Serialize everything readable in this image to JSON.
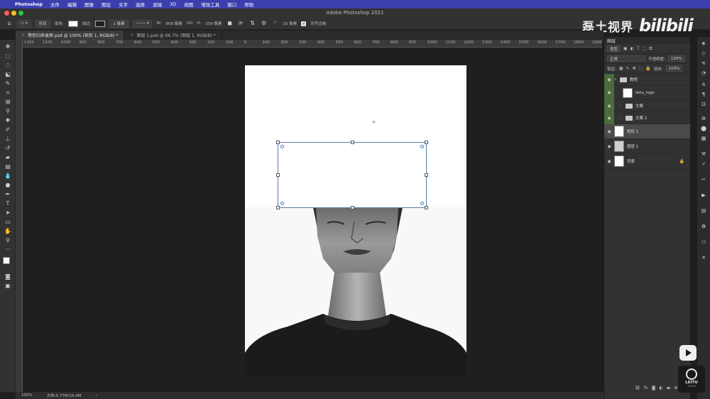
{
  "menubar": {
    "apple_glyph": "",
    "app": "Photoshop",
    "items": [
      "文件",
      "编辑",
      "图像",
      "图层",
      "文字",
      "选择",
      "滤镜",
      "3D",
      "视图",
      "增效工具",
      "窗口",
      "帮助"
    ]
  },
  "window": {
    "title": "Adobe Photoshop 2021"
  },
  "optbar": {
    "mode": "形状",
    "fill_label": "填充:",
    "stroke_label": "描边:",
    "stroke_width": "1 像素",
    "w_label": "W:",
    "w_value": "808 像素",
    "link_label": "GO",
    "h_label": "H:",
    "h_value": "359 像素",
    "radius": "10 像素",
    "align_edges": "对齐边缘"
  },
  "watermark": {
    "text": "磊土视界",
    "bilibili": "bilibili"
  },
  "tabs": [
    {
      "label": "等你归来录屏.psd @ 100% (矩形 1, RGB/8) *",
      "active": true
    },
    {
      "label": "图层 1.psb @ 66.7% (图层 1, RGB/8) *",
      "active": false
    }
  ],
  "ruler": [
    "1200",
    "1100",
    "1000",
    "900",
    "800",
    "700",
    "600",
    "500",
    "400",
    "300",
    "200",
    "100",
    "0",
    "100",
    "200",
    "300",
    "400",
    "500",
    "600",
    "700",
    "800",
    "900",
    "1000",
    "1100",
    "1200",
    "1300",
    "1400",
    "1500",
    "1600",
    "1700",
    "1800",
    "1900"
  ],
  "status": {
    "zoom": "100%",
    "doc": "文档:5.77M/19.4M",
    "arrow": "›"
  },
  "layers_panel": {
    "title": "图层",
    "filter_kind": "类型",
    "blend_mode": "正常",
    "opacity_label": "不透明度:",
    "opacity_value": "100%",
    "lock_label": "锁定:",
    "fill_label": "填充:",
    "fill_value": "100%",
    "layers": [
      {
        "name": "教程",
        "kind": "group",
        "expanded": true,
        "indent": 0,
        "green": true
      },
      {
        "name": "leitu_logo",
        "kind": "smart",
        "indent": 1,
        "green": true
      },
      {
        "name": "文案",
        "kind": "group",
        "expanded": false,
        "indent": 1,
        "green": true
      },
      {
        "name": "文案 2",
        "kind": "group",
        "expanded": false,
        "indent": 1,
        "green": true
      },
      {
        "name": "矩形 1",
        "kind": "shape",
        "indent": 0,
        "selected": true
      },
      {
        "name": "图层 1",
        "kind": "smart",
        "indent": 0
      },
      {
        "name": "背景",
        "kind": "background",
        "indent": 0,
        "locked": true
      }
    ],
    "bottom_icons": [
      "link-icon",
      "fx-icon",
      "mask-icon",
      "adjustment-icon",
      "group-icon",
      "new-layer-icon",
      "trash-icon"
    ]
  },
  "leitu": {
    "name": "LEITU",
    "sub": "VISION"
  },
  "colors": {
    "menubar": "#3b3fae",
    "panel": "#323232",
    "canvas_bg": "#1f1f1f",
    "selection": "#5b7da8"
  }
}
